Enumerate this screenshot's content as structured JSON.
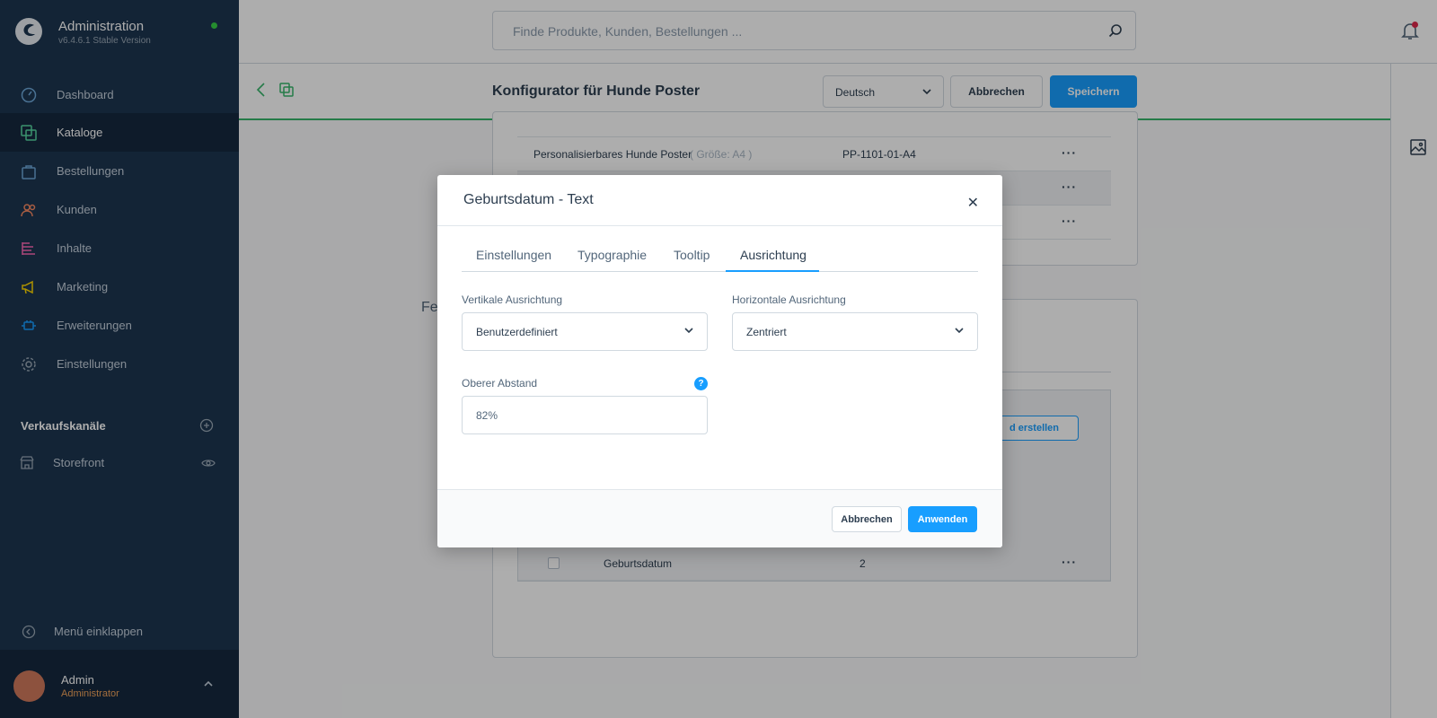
{
  "app": {
    "title": "Administration",
    "version": "v6.4.6.1 Stable Version"
  },
  "sidebar": {
    "items": [
      {
        "label": "Dashboard",
        "icon": "dashboard-icon"
      },
      {
        "label": "Kataloge",
        "icon": "catalog-icon"
      },
      {
        "label": "Bestellungen",
        "icon": "orders-icon"
      },
      {
        "label": "Kunden",
        "icon": "customers-icon"
      },
      {
        "label": "Inhalte",
        "icon": "content-icon"
      },
      {
        "label": "Marketing",
        "icon": "marketing-icon"
      },
      {
        "label": "Erweiterungen",
        "icon": "extensions-icon"
      },
      {
        "label": "Einstellungen",
        "icon": "settings-icon"
      }
    ],
    "active_index": 1,
    "sales_channels_title": "Verkaufskanäle",
    "storefront_label": "Storefront",
    "collapse_label": "Menü einklappen",
    "user": {
      "name": "Admin",
      "role": "Administrator"
    }
  },
  "topbar": {
    "search_placeholder": "Finde Produkte, Kunden, Bestellungen ..."
  },
  "smartbar": {
    "title": "Konfigurator für Hunde Poster",
    "language": "Deutsch",
    "cancel_label": "Abbrechen",
    "save_label": "Speichern"
  },
  "background": {
    "product_row": {
      "name": "Personalisierbares Hunde Poster",
      "variant": "( Größe: A4 )",
      "sku": "PP-1101-01-A4"
    },
    "field_row": {
      "name": "Geburtsdatum",
      "position": "2"
    },
    "section_text_partial": "Fe",
    "create_button_partial": "d erstellen",
    "more_glyph": "···"
  },
  "modal": {
    "title": "Geburtsdatum - Text",
    "close_glyph": "✕",
    "tabs": [
      "Einstellungen",
      "Typographie",
      "Tooltip",
      "Ausrichtung"
    ],
    "active_tab": "Ausrichtung",
    "vertical": {
      "label": "Vertikale Ausrichtung",
      "value": "Benutzerdefiniert"
    },
    "horizontal": {
      "label": "Horizontale Ausrichtung",
      "value": "Zentriert"
    },
    "top_offset": {
      "label": "Oberer Abstand",
      "value": "82%",
      "help_glyph": "?"
    },
    "cancel_label": "Abbrechen",
    "apply_label": "Anwenden"
  },
  "colors": {
    "sidebar_bg": "#1c3550",
    "primary": "#189eff",
    "success_border": "#37b56a",
    "avatar": "#d07a5c",
    "role": "#f1a35b"
  }
}
